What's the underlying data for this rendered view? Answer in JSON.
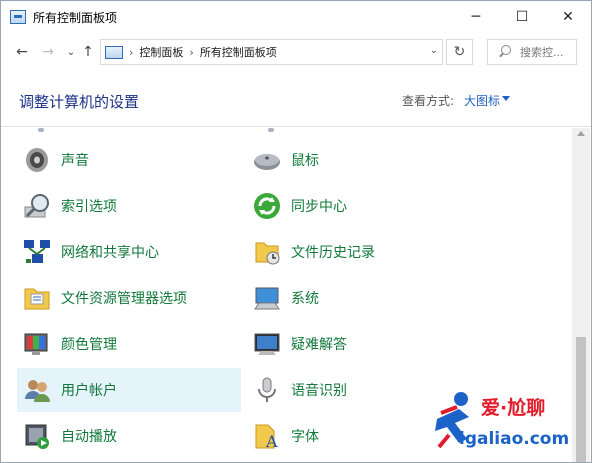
{
  "window": {
    "title": "所有控制面板项"
  },
  "caption": {
    "minimize": "─",
    "maximize": "☐",
    "close": "✕"
  },
  "nav": {
    "back": "←",
    "forward": "→",
    "recent": "⌄",
    "up": "↑",
    "breadcrumb": [
      "控制面板",
      "所有控制面板项"
    ],
    "separator": "›",
    "dropdown": "⌄",
    "refresh": "↻",
    "search_placeholder": "搜索控..."
  },
  "header": {
    "title": "调整计算机的设置",
    "view_label": "查看方式:",
    "view_value": "大图标"
  },
  "items": [
    {
      "label": "声音",
      "icon": "speaker-icon"
    },
    {
      "label": "鼠标",
      "icon": "mouse-icon"
    },
    {
      "label": "索引选项",
      "icon": "index-search-icon"
    },
    {
      "label": "同步中心",
      "icon": "sync-center-icon"
    },
    {
      "label": "网络和共享中心",
      "icon": "network-icon"
    },
    {
      "label": "文件历史记录",
      "icon": "file-history-icon"
    },
    {
      "label": "文件资源管理器选项",
      "icon": "folder-options-icon"
    },
    {
      "label": "系统",
      "icon": "system-icon"
    },
    {
      "label": "颜色管理",
      "icon": "color-management-icon"
    },
    {
      "label": "疑难解答",
      "icon": "troubleshooting-icon"
    },
    {
      "label": "用户帐户",
      "icon": "user-accounts-icon"
    },
    {
      "label": "语音识别",
      "icon": "microphone-icon"
    },
    {
      "label": "自动播放",
      "icon": "autoplay-icon"
    },
    {
      "label": "字体",
      "icon": "fonts-icon"
    }
  ],
  "watermark": {
    "top": "爱·尬聊",
    "bottom": "igaliao.com"
  },
  "colors": {
    "link_green": "#11783a",
    "title_blue": "#1e3287",
    "selection": "#e5f3fb",
    "accent": "#1f5fbf"
  }
}
